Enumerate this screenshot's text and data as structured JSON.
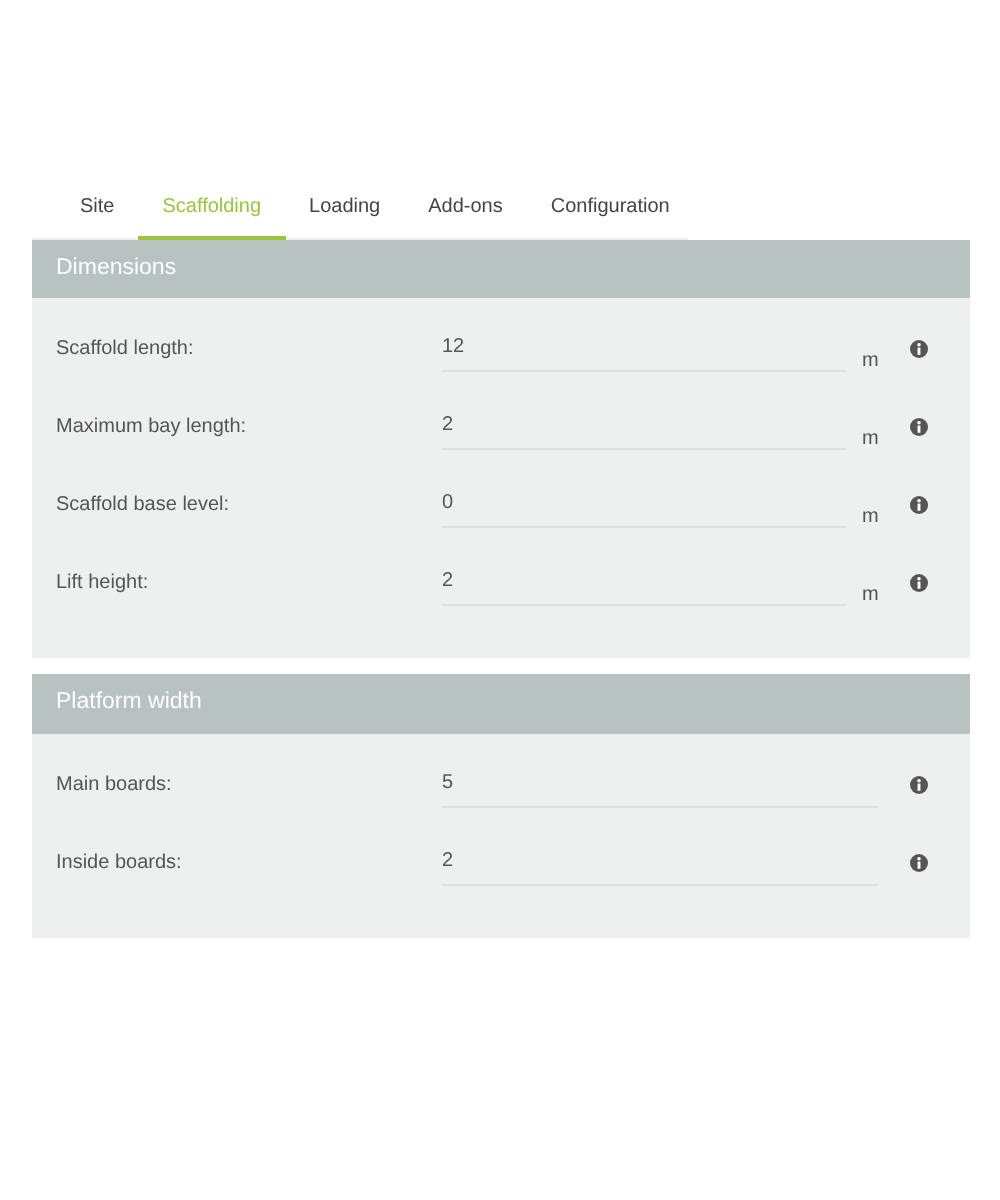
{
  "tabs": [
    {
      "label": "Site",
      "selected": false
    },
    {
      "label": "Scaffolding",
      "selected": true
    },
    {
      "label": "Loading",
      "selected": false
    },
    {
      "label": "Add-ons",
      "selected": false
    },
    {
      "label": "Configuration",
      "selected": false
    }
  ],
  "sections": [
    {
      "title": "Dimensions",
      "fields": [
        {
          "label": "Scaffold length:",
          "value": "12",
          "unit": "m"
        },
        {
          "label": "Maximum bay length:",
          "value": "2",
          "unit": "m"
        },
        {
          "label": "Scaffold base level:",
          "value": "0",
          "unit": "m"
        },
        {
          "label": "Lift height:",
          "value": "2",
          "unit": "m"
        }
      ]
    },
    {
      "title": "Platform width",
      "fields": [
        {
          "label": "Main boards:",
          "value": "5"
        },
        {
          "label": "Inside boards:",
          "value": "2"
        }
      ]
    }
  ]
}
